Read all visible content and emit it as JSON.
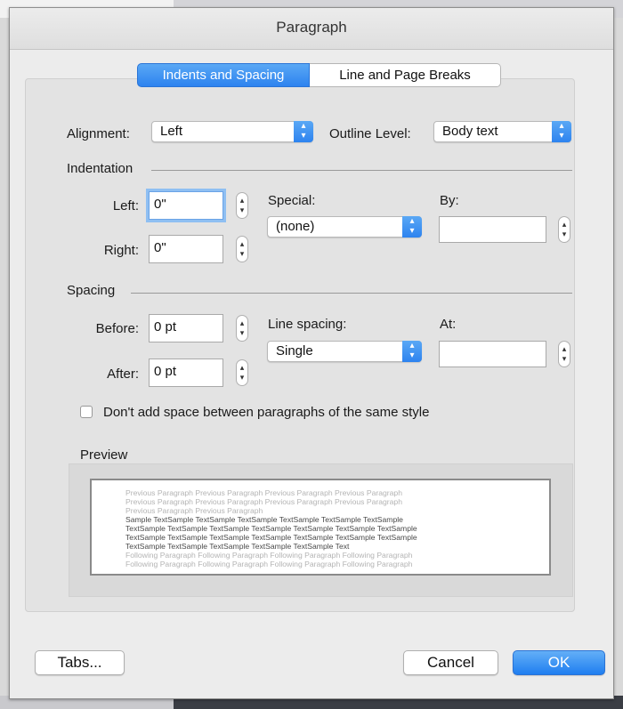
{
  "dialog": {
    "title": "Paragraph"
  },
  "tabs": [
    {
      "label": "Indents and Spacing",
      "active": true
    },
    {
      "label": "Line and Page Breaks",
      "active": false
    }
  ],
  "general": {
    "alignment_label": "Alignment:",
    "alignment_value": "Left",
    "outline_label": "Outline Level:",
    "outline_value": "Body text"
  },
  "indentation": {
    "section_label": "Indentation",
    "left_label": "Left:",
    "left_value": "0\"",
    "right_label": "Right:",
    "right_value": "0\"",
    "special_label": "Special:",
    "special_value": "(none)",
    "by_label": "By:",
    "by_value": ""
  },
  "spacing": {
    "section_label": "Spacing",
    "before_label": "Before:",
    "before_value": "0 pt",
    "after_label": "After:",
    "after_value": "0 pt",
    "line_spacing_label": "Line spacing:",
    "line_spacing_value": "Single",
    "at_label": "At:",
    "at_value": "",
    "dont_add_space_label": "Don't add space between paragraphs of the same style",
    "dont_add_space_checked": false
  },
  "preview": {
    "label": "Preview",
    "lines": [
      {
        "kind": "prev",
        "text": "Previous Paragraph Previous Paragraph Previous Paragraph Previous Paragraph"
      },
      {
        "kind": "prev",
        "text": "Previous Paragraph Previous Paragraph Previous Paragraph Previous Paragraph"
      },
      {
        "kind": "prev",
        "text": "Previous Paragraph Previous Paragraph"
      },
      {
        "kind": "sample",
        "text": "Sample TextSample TextSample TextSample TextSample TextSample TextSample"
      },
      {
        "kind": "sample",
        "text": "TextSample TextSample TextSample TextSample TextSample TextSample TextSample"
      },
      {
        "kind": "sample",
        "text": "TextSample TextSample TextSample TextSample TextSample TextSample TextSample"
      },
      {
        "kind": "sample",
        "text": "TextSample TextSample TextSample TextSample TextSample Text"
      },
      {
        "kind": "follow",
        "text": "Following Paragraph Following Paragraph Following Paragraph Following Paragraph"
      },
      {
        "kind": "follow",
        "text": "Following Paragraph Following Paragraph Following Paragraph Following Paragraph"
      }
    ]
  },
  "buttons": {
    "tabs": "Tabs...",
    "cancel": "Cancel",
    "ok": "OK"
  },
  "colors": {
    "accent": "#2d83ef",
    "preview_muted": "#b4b4b4"
  }
}
